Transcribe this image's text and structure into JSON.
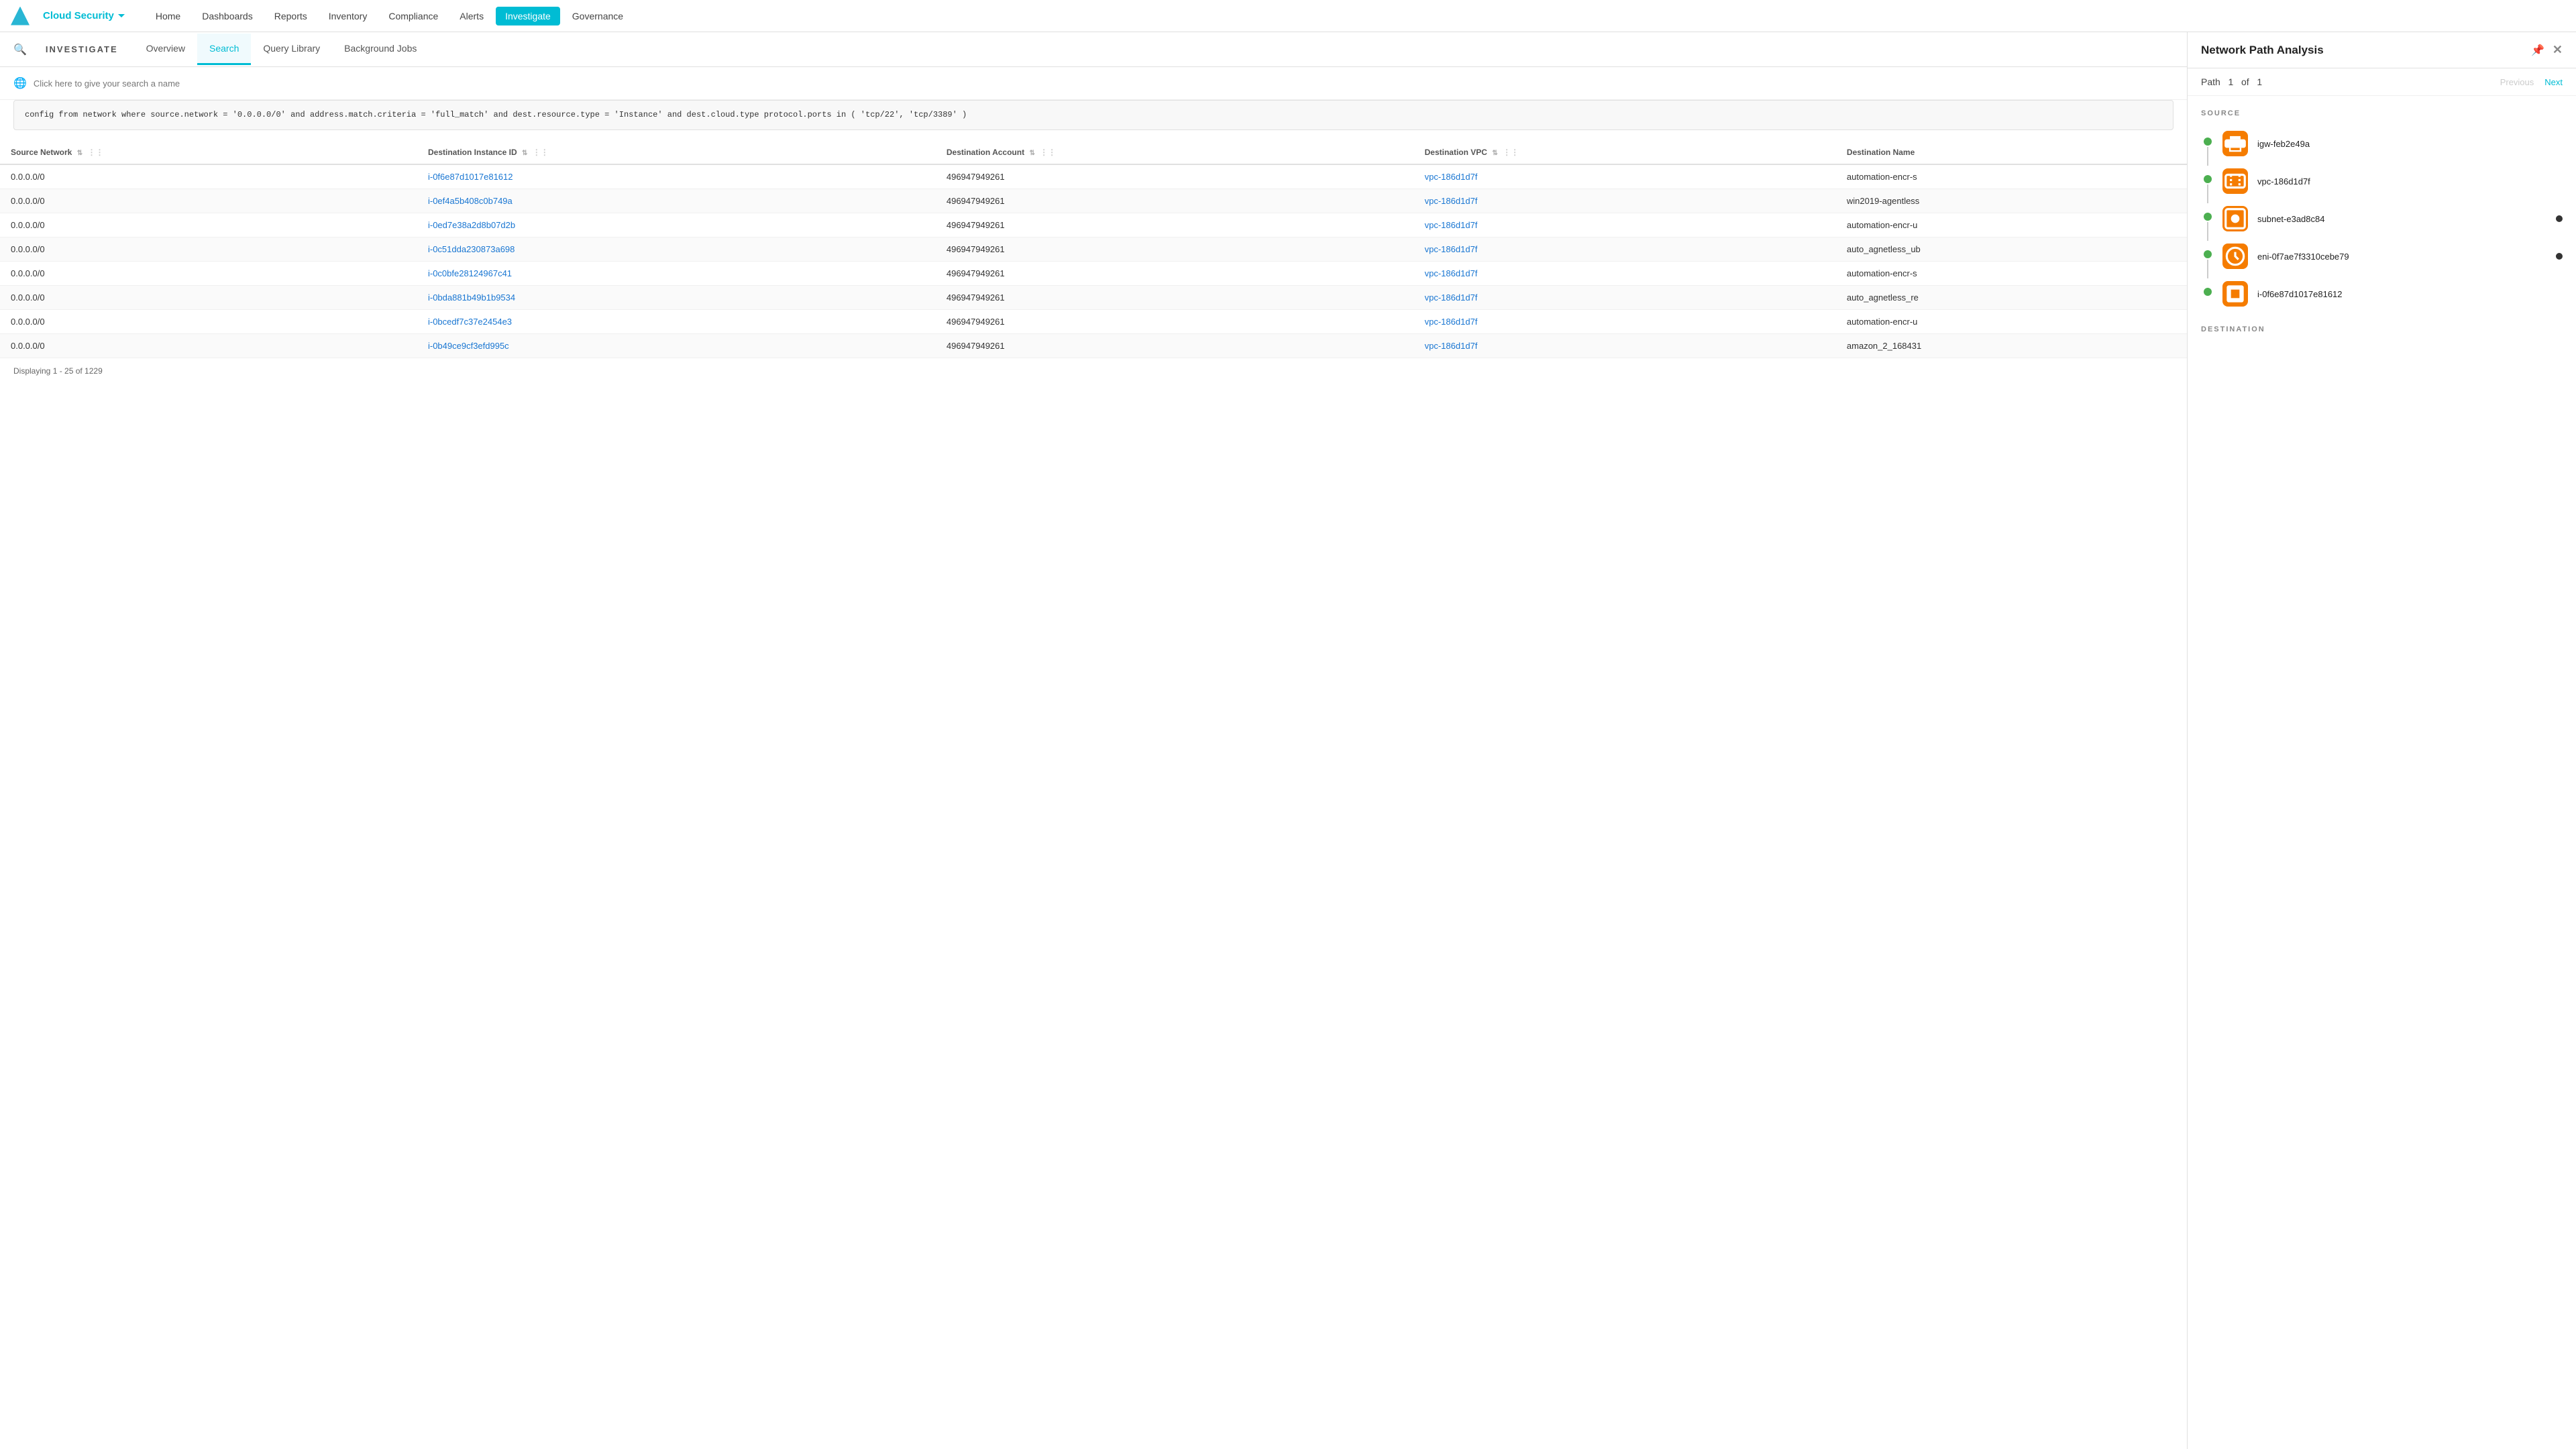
{
  "app": {
    "logo_alt": "Orca Security",
    "cloud_security_label": "Cloud Security"
  },
  "topnav": {
    "items": [
      {
        "id": "home",
        "label": "Home",
        "active": false
      },
      {
        "id": "dashboards",
        "label": "Dashboards",
        "active": false
      },
      {
        "id": "reports",
        "label": "Reports",
        "active": false
      },
      {
        "id": "inventory",
        "label": "Inventory",
        "active": false
      },
      {
        "id": "compliance",
        "label": "Compliance",
        "active": false
      },
      {
        "id": "alerts",
        "label": "Alerts",
        "active": false
      },
      {
        "id": "investigate",
        "label": "Investigate",
        "active": true
      },
      {
        "id": "governance",
        "label": "Governance",
        "active": false
      }
    ]
  },
  "investigate": {
    "header_label": "INVESTIGATE",
    "tabs": [
      {
        "id": "overview",
        "label": "Overview",
        "active": false
      },
      {
        "id": "search",
        "label": "Search",
        "active": true
      },
      {
        "id": "query_library",
        "label": "Query Library",
        "active": false
      },
      {
        "id": "background_jobs",
        "label": "Background Jobs",
        "active": false
      }
    ]
  },
  "search_name": {
    "icon": "🌐",
    "placeholder": "Click here to give your search a name"
  },
  "query": {
    "text": "config from network where source.network = '0.0.0.0/0' and address.match.criteria = 'full_match' and dest.resource.type = 'Instance' and dest.cloud.type\nprotocol.ports in ( 'tcp/22', 'tcp/3389' )"
  },
  "table": {
    "columns": [
      {
        "id": "source_network",
        "label": "Source Network"
      },
      {
        "id": "dest_instance_id",
        "label": "Destination Instance ID"
      },
      {
        "id": "dest_account",
        "label": "Destination Account"
      },
      {
        "id": "dest_vpc",
        "label": "Destination VPC"
      },
      {
        "id": "dest_name",
        "label": "Destination Name"
      }
    ],
    "rows": [
      {
        "source_network": "0.0.0.0/0",
        "dest_instance_id": "i-0f6e87d1017e81612",
        "dest_account": "496947949261",
        "dest_vpc": "vpc-186d1d7f",
        "dest_name": "automation-encr-s"
      },
      {
        "source_network": "0.0.0.0/0",
        "dest_instance_id": "i-0ef4a5b408c0b749a",
        "dest_account": "496947949261",
        "dest_vpc": "vpc-186d1d7f",
        "dest_name": "win2019-agentless"
      },
      {
        "source_network": "0.0.0.0/0",
        "dest_instance_id": "i-0ed7e38a2d8b07d2b",
        "dest_account": "496947949261",
        "dest_vpc": "vpc-186d1d7f",
        "dest_name": "automation-encr-u"
      },
      {
        "source_network": "0.0.0.0/0",
        "dest_instance_id": "i-0c51dda230873a698",
        "dest_account": "496947949261",
        "dest_vpc": "vpc-186d1d7f",
        "dest_name": "auto_agnetless_ub"
      },
      {
        "source_network": "0.0.0.0/0",
        "dest_instance_id": "i-0c0bfe28124967c41",
        "dest_account": "496947949261",
        "dest_vpc": "vpc-186d1d7f",
        "dest_name": "automation-encr-s"
      },
      {
        "source_network": "0.0.0.0/0",
        "dest_instance_id": "i-0bda881b49b1b9534",
        "dest_account": "496947949261",
        "dest_vpc": "vpc-186d1d7f",
        "dest_name": "auto_agnetless_re"
      },
      {
        "source_network": "0.0.0.0/0",
        "dest_instance_id": "i-0bcedf7c37e2454e3",
        "dest_account": "496947949261",
        "dest_vpc": "vpc-186d1d7f",
        "dest_name": "automation-encr-u"
      },
      {
        "source_network": "0.0.0.0/0",
        "dest_instance_id": "i-0b49ce9cf3efd995c",
        "dest_account": "496947949261",
        "dest_vpc": "vpc-186d1d7f",
        "dest_name": "amazon_2_168431"
      }
    ],
    "display_count": "Displaying 1 - 25 of 1229"
  },
  "right_panel": {
    "title": "Network Path Analysis",
    "path_label": "Path",
    "path_current": "1",
    "path_of": "of",
    "path_total": "1",
    "prev_label": "Previous",
    "next_label": "Next",
    "source_section_label": "SOURCE",
    "destination_section_label": "DESTINATION",
    "nodes": [
      {
        "id": "igw",
        "label": "igw-feb2e49a",
        "icon_type": "igw",
        "has_line": true,
        "has_right_dot": false
      },
      {
        "id": "vpc",
        "label": "vpc-186d1d7f",
        "icon_type": "vpc",
        "has_line": true,
        "has_right_dot": false
      },
      {
        "id": "subnet",
        "label": "subnet-e3ad8c84",
        "icon_type": "subnet",
        "has_line": true,
        "has_right_dot": true
      },
      {
        "id": "eni",
        "label": "eni-0f7ae7f3310cebe79",
        "icon_type": "eni",
        "has_line": true,
        "has_right_dot": true
      },
      {
        "id": "instance",
        "label": "i-0f6e87d1017e81612",
        "icon_type": "instance",
        "has_line": false,
        "has_right_dot": false
      }
    ]
  },
  "colors": {
    "accent": "#00bcd4",
    "orange": "#f57c00",
    "green": "#4caf50",
    "link": "#1976d2"
  }
}
